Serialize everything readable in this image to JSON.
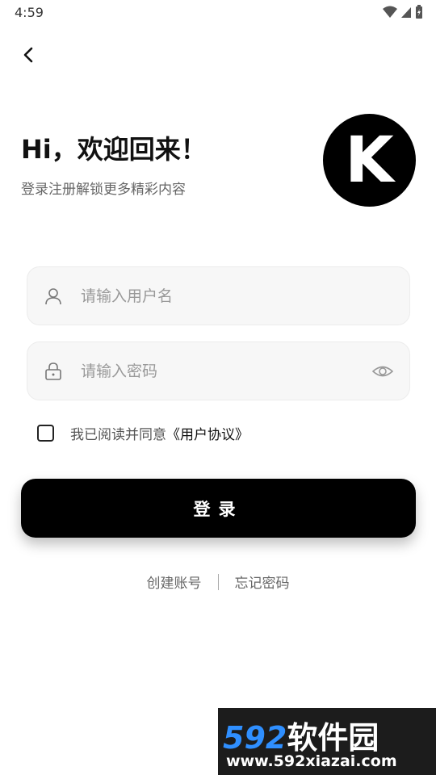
{
  "status_bar": {
    "time": "4:59"
  },
  "header": {
    "greeting": "Hi，欢迎回来！",
    "subtitle": "登录注册解锁更多精彩内容"
  },
  "logo": {
    "letter": "K"
  },
  "form": {
    "username_placeholder": "请输入用户名",
    "password_placeholder": "请输入密码",
    "agree_text": "我已阅读并同意",
    "agree_link": "《用户协议》",
    "login_label": "登录"
  },
  "links": {
    "create_account": "创建账号",
    "forgot_password": "忘记密码"
  },
  "watermark": {
    "brand_num": "592",
    "brand_cn": "软件园",
    "url": "www.592xiazai.com"
  },
  "colors": {
    "primary": "#000000",
    "field_bg": "#f7f7f7",
    "watermark_accent": "#2f8fff"
  }
}
